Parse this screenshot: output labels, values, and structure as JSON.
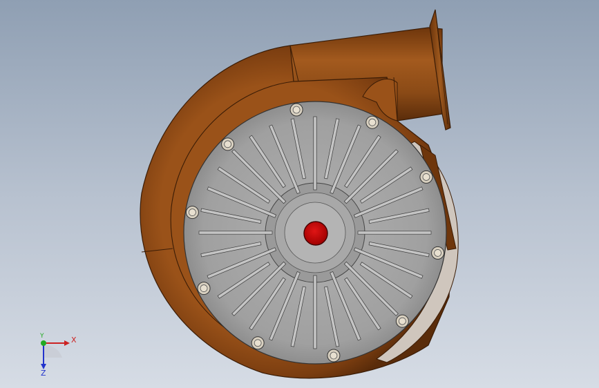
{
  "viewport": {
    "background_top": "#8f9fb3",
    "background_bottom": "#d6dce5"
  },
  "model": {
    "housing_color": "#8a4a16",
    "housing_dark": "#4e2608",
    "cover_color": "#a3a3a3",
    "hub_color": "#cc0000",
    "bolt_count": 10,
    "fin_count": 32
  },
  "triad": {
    "x_label": "X",
    "y_label": "Y",
    "z_label": "Z",
    "x_color": "#cc2222",
    "y_color": "#22aa22",
    "z_color": "#2233cc"
  }
}
